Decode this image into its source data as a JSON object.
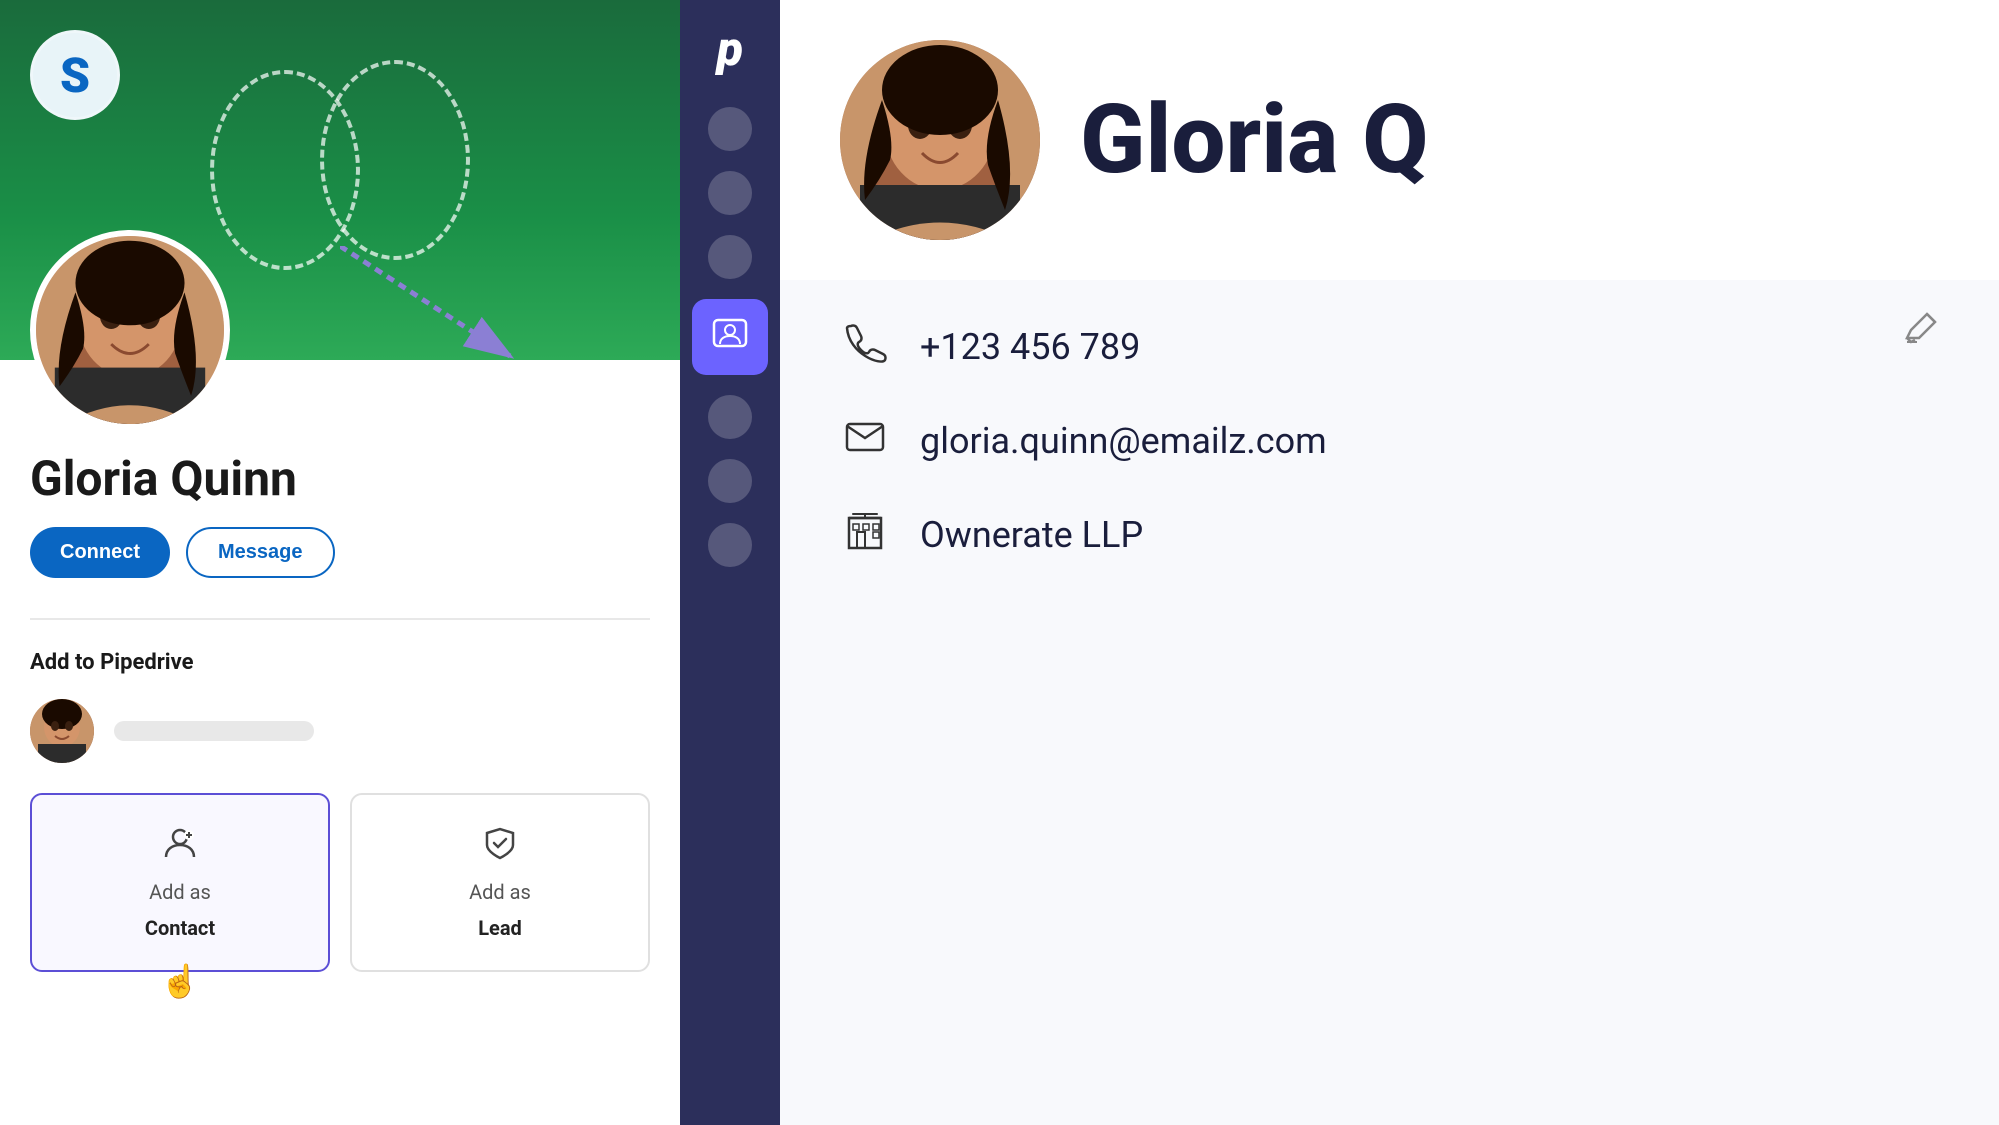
{
  "leftPanel": {
    "logoLetter": "S",
    "profileName": "Gloria Quinn",
    "connectLabel": "Connect",
    "messageLabel": "Message",
    "addToPipedriveLabel": "Add to Pipedrive",
    "addAsContactLabel": "Add as",
    "addAsContactBold": "Contact",
    "addAsLeadLabel": "Add as",
    "addAsLeadBold": "Lead"
  },
  "sidebar": {
    "logo": "p"
  },
  "rightPanel": {
    "contactName": "Gloria Q",
    "phone": "+123 456 789",
    "email": "gloria.quinn@emailz.com",
    "company": "Ownerate LLP"
  }
}
